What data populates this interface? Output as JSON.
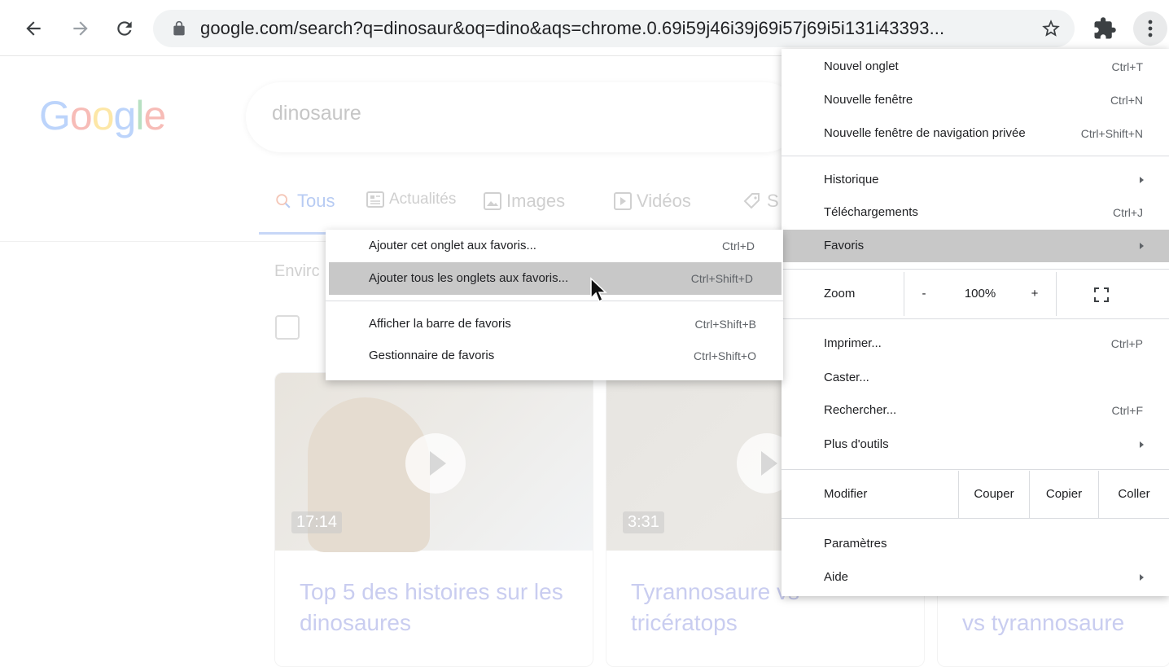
{
  "browser": {
    "url": "google.com/search?q=dinosaur&oq=dino&aqs=chrome.0.69i59j46i39j69i57j69i5i131i43393..."
  },
  "page": {
    "logo": {
      "G": "G",
      "o1": "o",
      "o2": "o",
      "g": "g",
      "l": "l",
      "e": "e"
    },
    "query": "dinosaure",
    "tabs": [
      {
        "label": "Tous",
        "icon": "search-icon"
      },
      {
        "label": "Actualités",
        "icon": "news-icon"
      },
      {
        "label": "Images",
        "icon": "image-icon"
      },
      {
        "label": "Vidéos",
        "icon": "video-icon"
      },
      {
        "label": "S",
        "icon": "tag-icon"
      }
    ],
    "results_about": "Envirc",
    "cards": [
      {
        "duration": "17:14",
        "title": "Top 5 des histoires sur les dinosaures"
      },
      {
        "duration": "3:31",
        "title": "Tyrannosaure vs tricératops"
      },
      {
        "title": "vs tyrannosaure"
      }
    ]
  },
  "menu": {
    "new_tab": {
      "label": "Nouvel onglet",
      "shortcut": "Ctrl+T"
    },
    "new_window": {
      "label": "Nouvelle fenêtre",
      "shortcut": "Ctrl+N"
    },
    "incognito": {
      "label": "Nouvelle fenêtre de navigation privée",
      "shortcut": "Ctrl+Shift+N"
    },
    "history": {
      "label": "Historique"
    },
    "downloads": {
      "label": "Téléchargements",
      "shortcut": "Ctrl+J"
    },
    "bookmarks": {
      "label": "Favoris"
    },
    "zoom": {
      "label": "Zoom",
      "minus": "-",
      "value": "100%",
      "plus": "+"
    },
    "print": {
      "label": "Imprimer...",
      "shortcut": "Ctrl+P"
    },
    "cast": {
      "label": "Caster..."
    },
    "find": {
      "label": "Rechercher...",
      "shortcut": "Ctrl+F"
    },
    "more_tools": {
      "label": "Plus d'outils"
    },
    "edit": {
      "label": "Modifier",
      "cut": "Couper",
      "copy": "Copier",
      "paste": "Coller"
    },
    "settings": {
      "label": "Paramètres"
    },
    "help": {
      "label": "Aide"
    }
  },
  "submenu": {
    "items": [
      {
        "label": "Ajouter cet onglet aux favoris...",
        "shortcut": "Ctrl+D"
      },
      {
        "label": "Ajouter tous les onglets aux favoris...",
        "shortcut": "Ctrl+Shift+D"
      },
      {
        "label": "Afficher la barre de favoris",
        "shortcut": "Ctrl+Shift+B"
      },
      {
        "label": "Gestionnaire de favoris",
        "shortcut": "Ctrl+Shift+O"
      }
    ]
  },
  "colors": {
    "highlight": "#c8c8c8",
    "logo_blue": "#4285f4",
    "logo_red": "#ea4335",
    "logo_yellow": "#fbbc05",
    "logo_green": "#34a853"
  }
}
